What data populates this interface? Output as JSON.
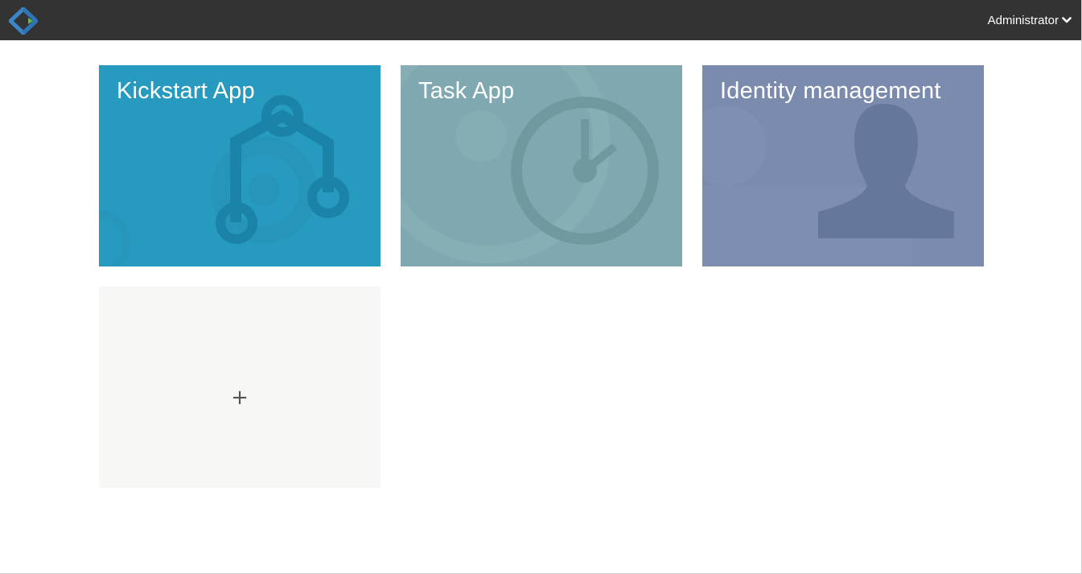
{
  "navbar": {
    "logo_icon": "flowable-diamond-logo",
    "user_label": "Administrator",
    "user_menu_icon": "chevron-down-icon"
  },
  "apps": [
    {
      "title": "Kickstart App",
      "icon": "process-flow-icon",
      "color": "#269abf"
    },
    {
      "title": "Task App",
      "icon": "clock-icon",
      "color": "#7fa8b0"
    },
    {
      "title": "Identity management",
      "icon": "user-silhouette-icon",
      "color": "#7b8bae"
    }
  ],
  "add_tile": {
    "label": "+",
    "color": "#f7f7f5"
  }
}
